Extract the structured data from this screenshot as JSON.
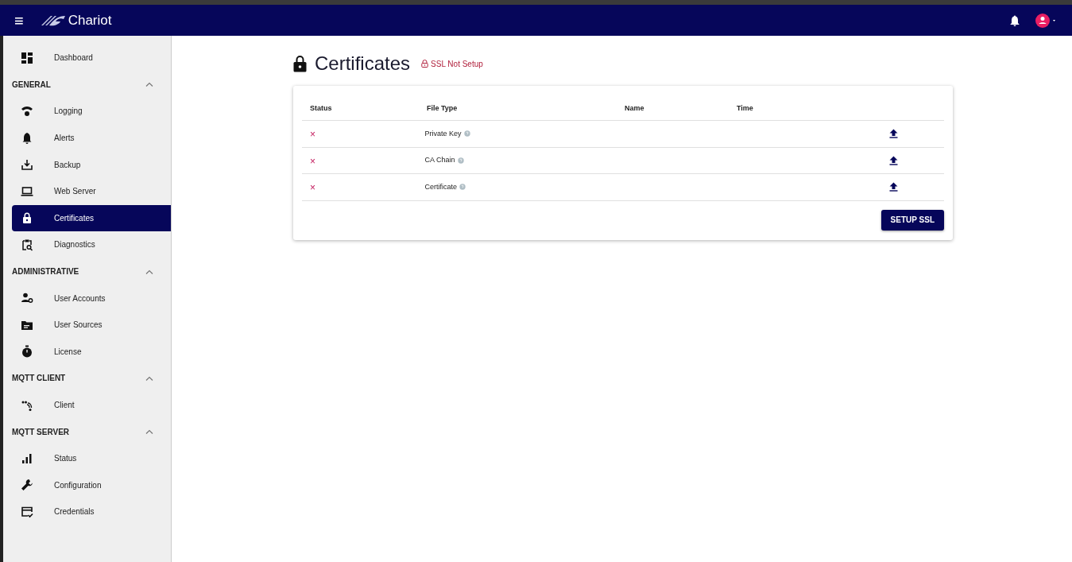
{
  "app_bar": {
    "menu_glyph": "≡",
    "brand": "Chariot"
  },
  "sidebar": {
    "items": [
      {
        "label": "Dashboard",
        "selected": false
      }
    ],
    "sections": [
      {
        "title": "GENERAL",
        "expanded": true,
        "items": [
          {
            "label": "Logging",
            "selected": false
          },
          {
            "label": "Alerts",
            "selected": false
          },
          {
            "label": "Backup",
            "selected": false
          },
          {
            "label": "Web Server",
            "selected": false
          },
          {
            "label": "Certificates",
            "selected": true
          },
          {
            "label": "Diagnostics",
            "selected": false
          }
        ]
      },
      {
        "title": "ADMINISTRATIVE",
        "expanded": true,
        "items": [
          {
            "label": "User Accounts",
            "selected": false
          },
          {
            "label": "User Sources",
            "selected": false
          },
          {
            "label": "License",
            "selected": false
          }
        ]
      },
      {
        "title": "MQTT CLIENT",
        "expanded": true,
        "items": [
          {
            "label": "Client",
            "selected": false
          }
        ]
      },
      {
        "title": "MQTT SERVER",
        "expanded": true,
        "items": [
          {
            "label": "Status",
            "selected": false
          },
          {
            "label": "Configuration",
            "selected": false
          },
          {
            "label": "Credentials",
            "selected": false
          }
        ]
      }
    ]
  },
  "page": {
    "title": "Certificates",
    "badge": "SSL Not Setup"
  },
  "table": {
    "columns": [
      "Status",
      "File Type",
      "Name",
      "Time"
    ],
    "rows": [
      {
        "uploaded": false,
        "status_glyph": "×",
        "file_type": "Private Key"
      },
      {
        "uploaded": false,
        "status_glyph": "×",
        "file_type": "CA Chain"
      },
      {
        "uploaded": false,
        "status_glyph": "×",
        "file_type": "Certificate"
      }
    ]
  },
  "button": "SETUP SSL"
}
